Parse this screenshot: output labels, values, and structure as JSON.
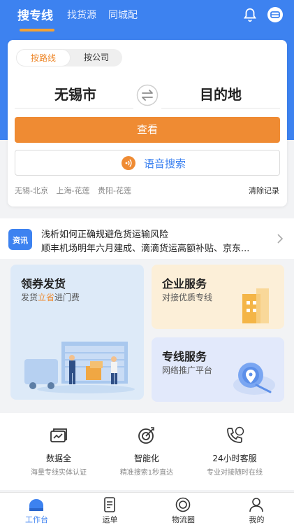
{
  "topbar": {
    "tabs": [
      {
        "label": "搜专线",
        "active": true
      },
      {
        "label": "找货源",
        "active": false
      },
      {
        "label": "同城配",
        "active": false
      }
    ]
  },
  "search": {
    "modes": [
      "按路线",
      "按公司"
    ],
    "origin": "无锡市",
    "destination": "目的地",
    "view_label": "查看",
    "voice_label": "语音搜索",
    "history": [
      "无锡-北京",
      "上海-花莲",
      "贵阳-花莲"
    ],
    "clear_label": "清除记录"
  },
  "news": {
    "badge": "资讯",
    "lines": [
      "浅析如何正确规避危货运输风险",
      "顺丰机场明年六月建成、滴滴货运高额补贴、京东..."
    ]
  },
  "cards": {
    "coupon": {
      "title": "领券发货",
      "sub_prefix": "发货",
      "sub_highlight": "立省",
      "sub_suffix": "进门费"
    },
    "enterprise": {
      "title": "企业服务",
      "sub": "对接优质专线"
    },
    "line": {
      "title": "专线服务",
      "sub": "网络推广平台"
    }
  },
  "features": [
    {
      "title": "数据全",
      "sub": "海量专线实体认证",
      "icon": "data-icon"
    },
    {
      "title": "智能化",
      "sub": "精准搜索1秒直达",
      "icon": "target-icon"
    },
    {
      "title": "24小时客服",
      "sub": "专业对接随时在线",
      "icon": "phone-icon"
    }
  ],
  "bottom_nav": [
    {
      "label": "工作台",
      "active": true
    },
    {
      "label": "运单",
      "active": false
    },
    {
      "label": "物流圈",
      "active": false
    },
    {
      "label": "我的",
      "active": false
    }
  ],
  "colors": {
    "primary": "#3d82f0",
    "accent": "#ef8b33"
  }
}
